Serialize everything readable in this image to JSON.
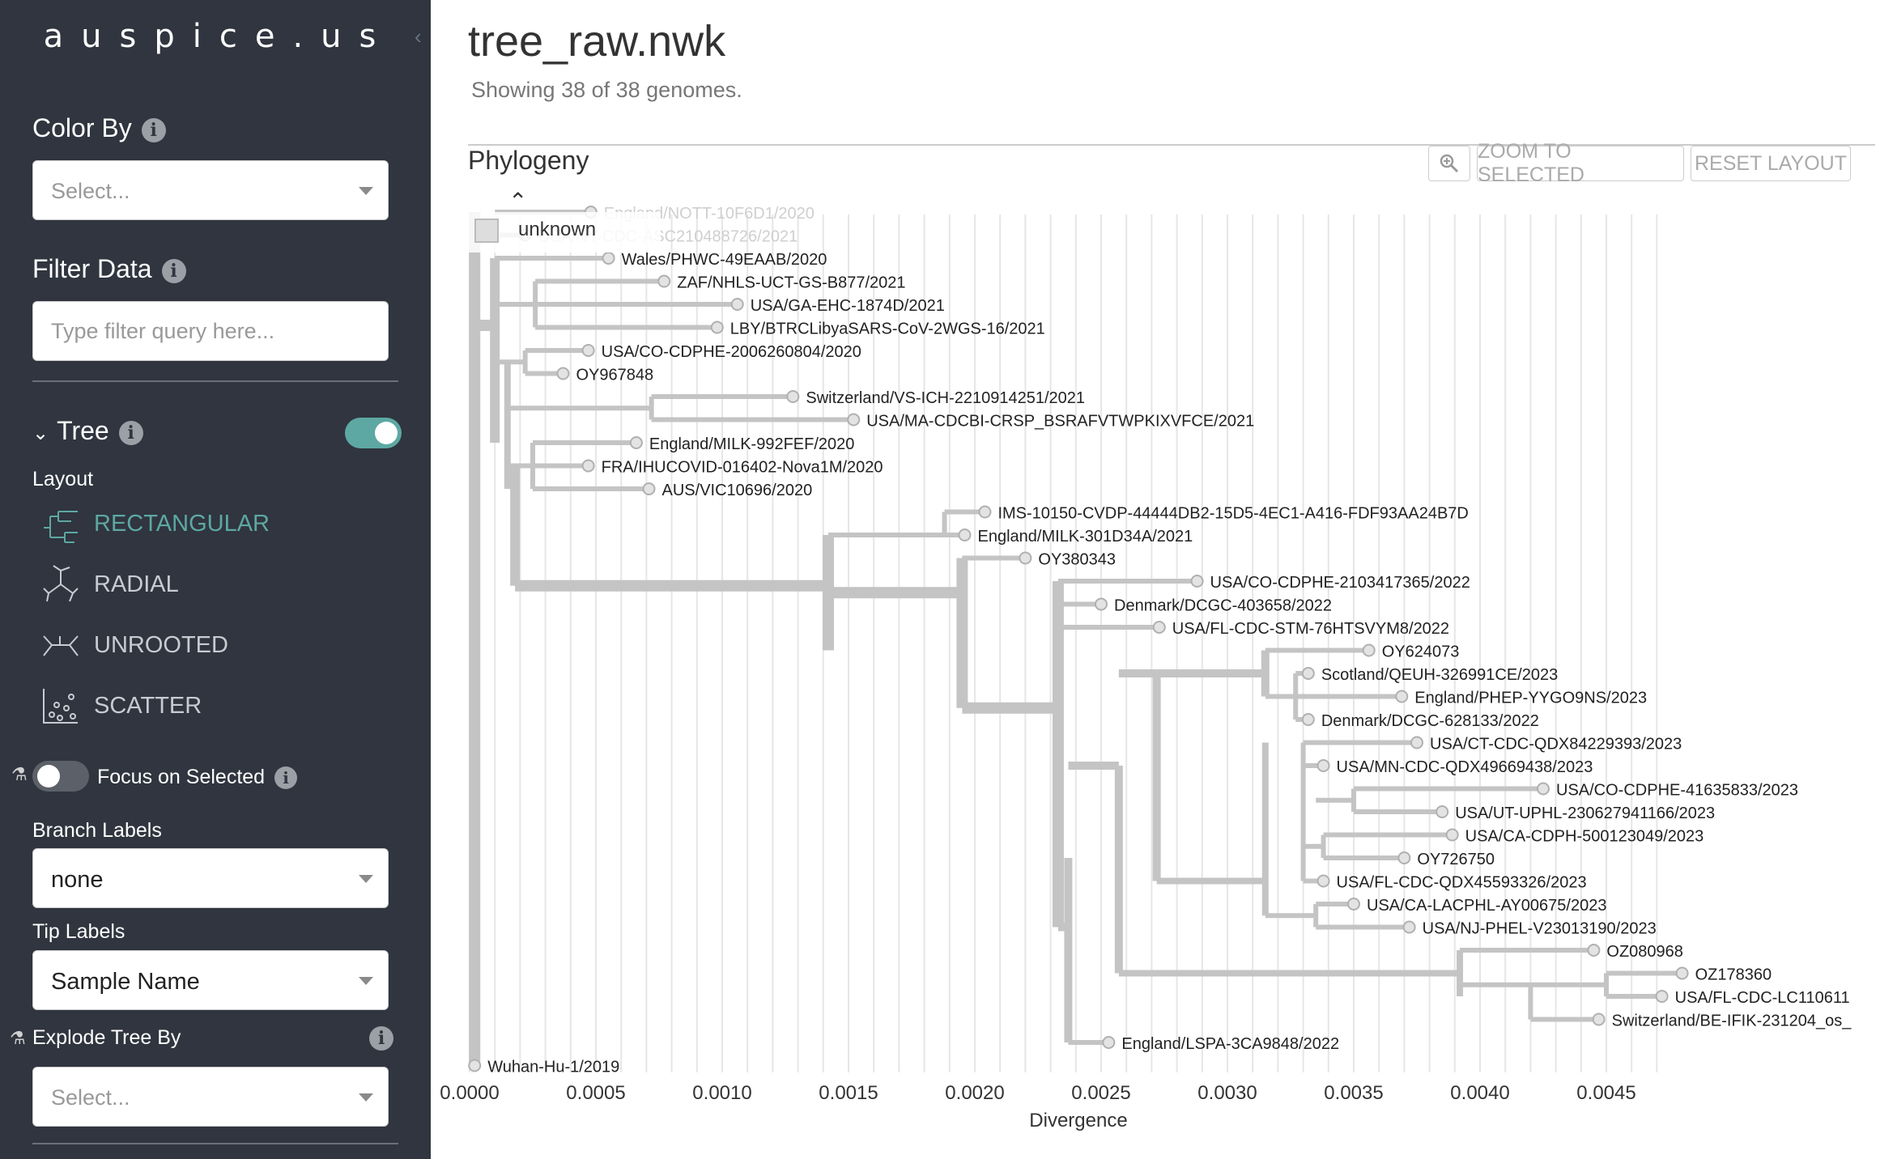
{
  "sidebar": {
    "brand": "auspice.us",
    "color_by": {
      "title": "Color By",
      "value": "Select..."
    },
    "filter": {
      "title": "Filter Data",
      "placeholder": "Type filter query here..."
    },
    "tree": {
      "title": "Tree",
      "enabled": true
    },
    "layout": {
      "label": "Layout",
      "options": [
        "RECTANGULAR",
        "RADIAL",
        "UNROOTED",
        "SCATTER"
      ],
      "active": "RECTANGULAR"
    },
    "focus": {
      "label": "Focus on Selected",
      "enabled": false
    },
    "branch_labels": {
      "label": "Branch Labels",
      "value": "none"
    },
    "tip_labels": {
      "label": "Tip Labels",
      "value": "Sample Name"
    },
    "explode": {
      "label": "Explode Tree By",
      "value": "Select..."
    }
  },
  "header": {
    "title": "tree_raw.nwk",
    "subtitle": "Showing 38 of 38 genomes."
  },
  "panel": {
    "title": "Phylogeny",
    "zoom_label": "ZOOM TO SELECTED",
    "reset_label": "RESET LAYOUT",
    "legend_item": "unknown"
  },
  "colors": {
    "accent": "#5da8a3",
    "sidebar_bg": "#30353f",
    "branch": "#c4c4c4"
  },
  "tree_axis": {
    "label": "Divergence",
    "ticks": [
      "0.0000",
      "0.0005",
      "0.0010",
      "0.0015",
      "0.0020",
      "0.0025",
      "0.0030",
      "0.0035",
      "0.0040",
      "0.0045"
    ]
  },
  "tips": [
    "England/NOTT-10F6D1/2020",
    "USA/NY-CDC-ASC210488726/2021",
    "Wales/PHWC-49EAAB/2020",
    "ZAF/NHLS-UCT-GS-B877/2021",
    "USA/GA-EHC-1874D/2021",
    "LBY/BTRCLibyaSARS-CoV-2WGS-16/2021",
    "USA/CO-CDPHE-2006260804/2020",
    "OY967848",
    "Switzerland/VS-ICH-2210914251/2021",
    "USA/MA-CDCBI-CRSP_BSRAFVTWPKIXVFCE/2021",
    "England/MILK-992FEF/2020",
    "FRA/IHUCOVID-016402-Nova1M/2020",
    "AUS/VIC10696/2020",
    "IMS-10150-CVDP-44444DB2-15D5-4EC1-A416-FDF93AA24B7D",
    "England/MILK-301D34A/2021",
    "OY380343",
    "USA/CO-CDPHE-2103417365/2022",
    "Denmark/DCGC-403658/2022",
    "USA/FL-CDC-STM-76HTSVYM8/2022",
    "OY624073",
    "Scotland/QEUH-326991CE/2023",
    "England/PHEP-YYGO9NS/2023",
    "Denmark/DCGC-628133/2022",
    "USA/CT-CDC-QDX84229393/2023",
    "USA/MN-CDC-QDX49669438/2023",
    "USA/CO-CDPHE-41635833/2023",
    "USA/UT-UPHL-230627941166/2023",
    "USA/CA-CDPH-500123049/2023",
    "OY726750",
    "USA/FL-CDC-QDX45593326/2023",
    "USA/CA-LACPHL-AY00675/2023",
    "USA/NJ-PHEL-V23013190/2023",
    "OZ080968",
    "OZ178360",
    "USA/FL-CDC-LC110611",
    "Switzerland/BE-IFIK-231204_os_",
    "England/LSPA-3CA9848/2022",
    "Wuhan-Hu-1/2019"
  ]
}
